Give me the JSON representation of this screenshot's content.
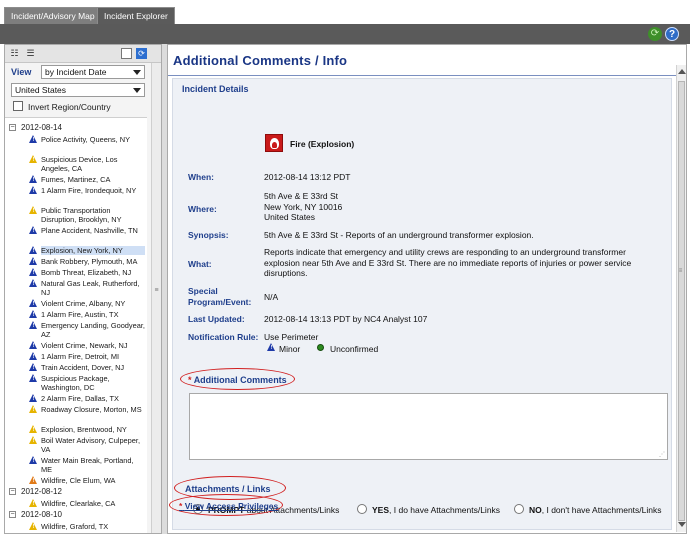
{
  "tabs": [
    {
      "label": "Incident/Advisory Map",
      "active": false
    },
    {
      "label": "Incident Explorer",
      "active": true
    }
  ],
  "toolbar": {
    "refresh_icon": "refresh-icon",
    "help_icon": "help-icon",
    "help_glyph": "?",
    "refresh_glyph": "⟳"
  },
  "left_panel": {
    "view_label": "View",
    "view_select": "by Incident Date",
    "region_select": "United States",
    "invert_label": "Invert Region/Country",
    "invert_checked": false,
    "tree": [
      {
        "type": "date",
        "label": "2012-08-14"
      },
      {
        "type": "item",
        "icon": "blue",
        "label": "Police Activity, Queens, NY"
      },
      {
        "type": "item",
        "icon": "yellow",
        "label": "Suspicious Device, Los Angeles, CA"
      },
      {
        "type": "item",
        "icon": "blue",
        "label": "Fumes, Martinez, CA"
      },
      {
        "type": "item",
        "icon": "blue",
        "label": "1 Alarm Fire, Irondequoit, NY"
      },
      {
        "type": "item",
        "icon": "yellow",
        "label": "Public Transportation Disruption, Brooklyn, NY"
      },
      {
        "type": "item",
        "icon": "blue",
        "label": "Plane Accident, Nashville, TN"
      },
      {
        "type": "item",
        "icon": "blue",
        "label": "Explosion, New York, NY",
        "selected": true
      },
      {
        "type": "item",
        "icon": "blue",
        "label": "Bank Robbery, Plymouth, MA"
      },
      {
        "type": "item",
        "icon": "blue",
        "label": "Bomb Threat, Elizabeth, NJ"
      },
      {
        "type": "item",
        "icon": "blue",
        "label": "Natural Gas Leak, Rutherford, NJ"
      },
      {
        "type": "item",
        "icon": "blue",
        "label": "Violent Crime, Albany, NY"
      },
      {
        "type": "item",
        "icon": "blue",
        "label": "1 Alarm Fire, Austin, TX"
      },
      {
        "type": "item",
        "icon": "blue",
        "label": "Emergency Landing, Goodyear, AZ"
      },
      {
        "type": "item",
        "icon": "blue",
        "label": "Violent Crime, Newark, NJ"
      },
      {
        "type": "item",
        "icon": "blue",
        "label": "1 Alarm Fire, Detroit, MI"
      },
      {
        "type": "item",
        "icon": "blue",
        "label": "Train Accident, Dover, NJ"
      },
      {
        "type": "item",
        "icon": "blue",
        "label": "Suspicious Package, Washington, DC"
      },
      {
        "type": "item",
        "icon": "blue",
        "label": "2 Alarm Fire, Dallas, TX"
      },
      {
        "type": "item",
        "icon": "yellow",
        "label": "Roadway Closure, Morton, MS"
      },
      {
        "type": "item",
        "icon": "yellow",
        "label": "Explosion, Brentwood, NY"
      },
      {
        "type": "item",
        "icon": "yellow",
        "label": "Boil Water Advisory, Culpeper, VA"
      },
      {
        "type": "item",
        "icon": "blue",
        "label": "Water Main Break, Portland, ME"
      },
      {
        "type": "item",
        "icon": "orange",
        "label": "Wildfire, Cle Elum, WA"
      },
      {
        "type": "date",
        "label": "2012-08-12"
      },
      {
        "type": "item",
        "icon": "yellow",
        "label": "Wildfire, Clearlake, CA"
      },
      {
        "type": "date",
        "label": "2012-08-10"
      },
      {
        "type": "item",
        "icon": "yellow",
        "label": "Wildfire, Graford, TX"
      }
    ]
  },
  "main": {
    "title": "Additional Comments / Info",
    "incident_details_label": "Incident Details",
    "incident_type": "Fire (Explosion)",
    "fields": {
      "when_label": "When:",
      "when_value": "2012-08-14 13:12 PDT",
      "where_label": "Where:",
      "where_line1": "5th Ave & E 33rd St",
      "where_line2": "New York, NY 10016",
      "where_line3": "United States",
      "synopsis_label": "Synopsis:",
      "synopsis_value": "5th Ave & E 33rd St - Reports of an underground transformer explosion.",
      "what_label": "What:",
      "what_line1": "Reports indicate that emergency and utility crews are responding to an underground transformer",
      "what_line2": "explosion near 5th Ave and E 33rd St. There are no immediate reports of injuries or power service",
      "what_line3": "disruptions.",
      "special_label_line1": "Special",
      "special_label_line2": "Program/Event:",
      "special_value": "N/A",
      "last_updated_label": "Last Updated:",
      "last_updated_value": "2012-08-14 13:13 PDT by NC4 Analyst 107",
      "notification_label": "Notification Rule:",
      "notification_value": "Use Perimeter"
    },
    "severity": "Minor",
    "confirmation": "Unconfirmed",
    "additional_comments": {
      "required_mark": "*",
      "label": "Additional Comments",
      "value": ""
    },
    "attachments": {
      "label": "Attachments / Links",
      "options": [
        {
          "bold": "PROMPT",
          "rest": " about Attachments/Links",
          "selected": true
        },
        {
          "bold": "YES",
          "rest": ", I do have Attachments/Links",
          "selected": false
        },
        {
          "bold": "NO",
          "rest": ", I don't have Attachments/Links",
          "selected": false
        }
      ]
    },
    "access_link": {
      "required_mark": "*",
      "label": "View Access Privileges"
    },
    "highlight_color": "#d11f1f",
    "title_color": "#1a3685"
  }
}
